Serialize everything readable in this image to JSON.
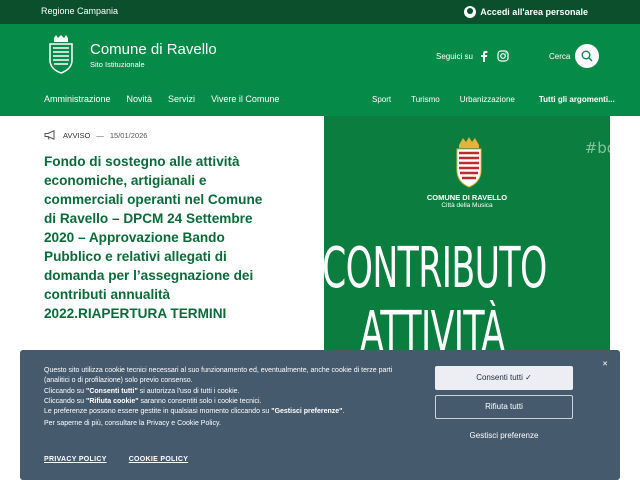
{
  "topbar": {
    "region": "Regione Campania",
    "login": "Accedi all'area personale"
  },
  "header": {
    "site_name": "Comune di Ravello",
    "site_sub": "Sito Istituzionale",
    "social_label": "Seguici su",
    "search_label": "Cerca"
  },
  "nav_main": [
    "Amministrazione",
    "Novità",
    "Servizi",
    "Vivere il Comune"
  ],
  "nav_secondary": [
    "Sport",
    "Turismo",
    "Urbanizzazione",
    "Tutti gli argomenti..."
  ],
  "article": {
    "type": "AVVISO",
    "date": "15/01/2026",
    "title": "Fondo di sostegno alle attività economiche, artigianali e commerciali operanti nel Comune di Ravello – DPCM 24 Settembre 2020 – Approvazione Bando Pubblico e relativi allegati di domanda per l’assegnazione dei contributi annualità 2022.RIAPERTURA TERMINI"
  },
  "hero": {
    "tag": "#bo",
    "comune": "COMUNE DI RAVELLO",
    "citta": "Città della Musica",
    "line1": "CONTRIBUTO",
    "line2": "ATTIVITÀ"
  },
  "cookie": {
    "p1": "Questo sito utilizza cookie tecnici necessari al suo funzionamento ed, eventualmente, anche cookie di terze parti (analitici o di profilazione) solo previo consenso.",
    "p2_pre": "Cliccando su ",
    "p2_bold": "\"Consenti tutti\"",
    "p2_post": " si autorizza l'uso di tutti i cookie.",
    "p3_pre": "Cliccando su ",
    "p3_bold": "\"Rifiuta cookie\"",
    "p3_post": " saranno consentiti solo i cookie tecnici.",
    "p4_pre": "Le preferenze possono essere gestite in qualsiasi momento cliccando su ",
    "p4_bold": "\"Gestisci preferenze\"",
    "p4_post": ".",
    "p5": "Per saperne di più, consultare la Privacy e Cookie Policy.",
    "accept": "Consenti tutti ✓",
    "reject": "Rifiuta tutti",
    "manage": "Gestisci preferenze",
    "privacy": "PRIVACY POLICY",
    "cookie_policy": "COOKIE POLICY",
    "close": "✕"
  },
  "colors": {
    "dark_green": "#0b4f2d",
    "green": "#068a48",
    "title_green": "#0a6b39",
    "banner": "#465a6e"
  }
}
